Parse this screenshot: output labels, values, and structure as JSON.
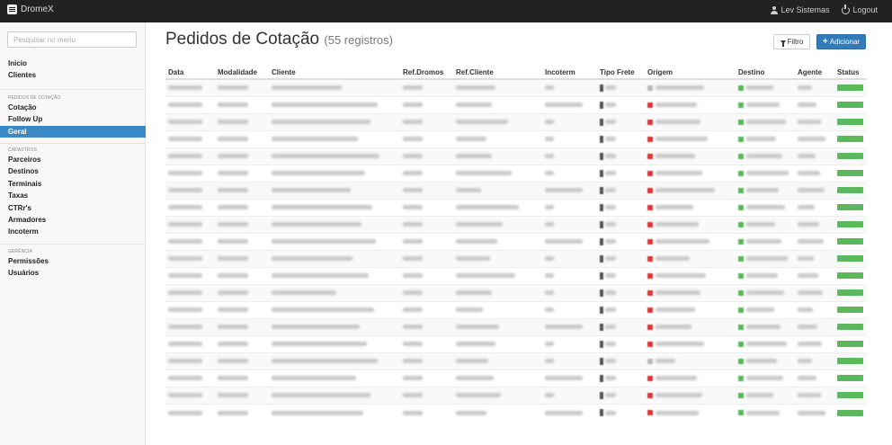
{
  "app": {
    "brand": "DromeX"
  },
  "topbar": {
    "user": "Lev Sistemas",
    "logout": "Logout"
  },
  "sidebar": {
    "search_placeholder": "Pesquisar no menu",
    "top_items": [
      "Inicio",
      "Clientes"
    ],
    "groups": [
      {
        "title": "PEDIDOS DE COTAÇÃO",
        "items": [
          "Cotação",
          "Follow Up",
          "Geral"
        ],
        "active": "Geral"
      },
      {
        "title": "CADASTROS",
        "items": [
          "Parceiros",
          "Destinos",
          "Terminais",
          "Taxas",
          "CTRr's",
          "Armadores",
          "Incoterm"
        ]
      },
      {
        "title": "GERÊNCIA",
        "items": [
          "Permissões",
          "Usuários"
        ]
      }
    ]
  },
  "main": {
    "title": "Pedidos de Cotação",
    "count": "(55 registros)",
    "filter_label": "Filtro",
    "add_label": "Adicionar",
    "columns": [
      "Data",
      "Modalidade",
      "Cliente",
      "Ref.Dromos",
      "Ref.Cliente",
      "Incoterm",
      "Tipo Frete",
      "Origem",
      "Destino",
      "Agente",
      "Status"
    ],
    "rows_note_hidden": "",
    "status_color": "#5cb85c",
    "accent": "#337ab7"
  }
}
